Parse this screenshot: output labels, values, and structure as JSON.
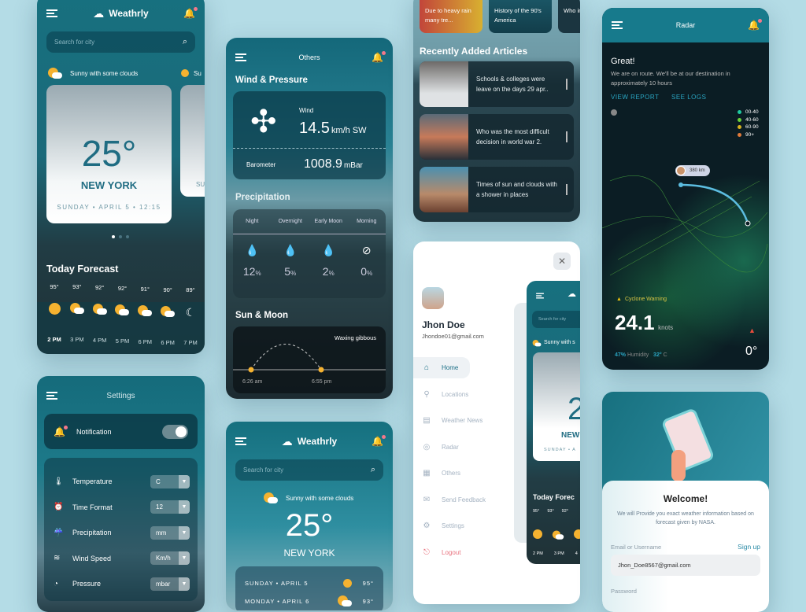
{
  "app_name": "Weathrly",
  "home": {
    "search_placeholder": "Search for city",
    "condition": "Sunny with some clouds",
    "condition2": "Su",
    "temp": "25°",
    "city": "NEW YORK",
    "datetime": "SUNDAY • APRIL 5 • 12:15",
    "next_card_text": "SU",
    "forecast_title": "Today Forecast",
    "forecast": [
      {
        "temp": "95°",
        "icon": "sun",
        "time": "2 PM"
      },
      {
        "temp": "93°",
        "icon": "partly-cloudy",
        "time": "3 PM"
      },
      {
        "temp": "92°",
        "icon": "partly-cloudy",
        "time": "4 PM"
      },
      {
        "temp": "92°",
        "icon": "partly-cloudy",
        "time": "5 PM"
      },
      {
        "temp": "91°",
        "icon": "partly-cloudy",
        "time": "6 PM"
      },
      {
        "temp": "90°",
        "icon": "partly-cloudy",
        "time": "6 PM"
      },
      {
        "temp": "89°",
        "icon": "moon-cloud",
        "time": "7 PM"
      }
    ]
  },
  "settings": {
    "title": "Settings",
    "notification_label": "Notification",
    "notification_on": true,
    "items": [
      {
        "label": "Temperature",
        "value": "C",
        "icon": "thermometer"
      },
      {
        "label": "Time Format",
        "value": "12",
        "icon": "alarm-clock"
      },
      {
        "label": "Precipitation",
        "value": "mm",
        "icon": "rain-cloud"
      },
      {
        "label": "Wind Speed",
        "value": "Km/h",
        "icon": "wind"
      },
      {
        "label": "Pressure",
        "value": "mbar",
        "icon": "gauge"
      }
    ]
  },
  "others": {
    "title": "Others",
    "wind_section": "Wind & Pressure",
    "wind_label": "Wind",
    "wind_value": "14.5",
    "wind_unit": "km/h SW",
    "barometer_label": "Barometer",
    "barometer_value": "1008.9",
    "barometer_unit": "mBar",
    "precip_section": "Precipitation",
    "precip": [
      {
        "label": "Night",
        "value": "12",
        "unit": "%"
      },
      {
        "label": "Overnight",
        "value": "5",
        "unit": "%"
      },
      {
        "label": "Early Moon",
        "value": "2",
        "unit": "%"
      },
      {
        "label": "Morning",
        "value": "0",
        "unit": "%"
      }
    ],
    "sun_section": "Sun & Moon",
    "moon_phase": "Waxing gibbous",
    "sunrise": "6:26 am",
    "sunset": "6:55 pm"
  },
  "home2": {
    "search_placeholder": "Search for city",
    "condition": "Sunny with some clouds",
    "temp": "25°",
    "city": "NEW YORK",
    "days": [
      {
        "label": "SUNDAY • APRIL 5",
        "temp": "95°",
        "icon": "sun"
      },
      {
        "label": "MONDAY • APRIL 6",
        "temp": "93°",
        "icon": "partly-cloudy"
      }
    ]
  },
  "news": {
    "top": [
      "Due to heavy rain many tre...",
      "History of the 90's America",
      "Who in w"
    ],
    "recent_title": "Recently Added Articles",
    "articles": [
      "Schools & colleges were leave on the days 29 apr..",
      "Who was the most difficult decision in world war 2.",
      "Times of sun and clouds with a shower in places"
    ]
  },
  "menu": {
    "user_name": "Jhon Doe",
    "user_email": "Jhondoe01@gmail.com",
    "items": [
      {
        "label": "Home",
        "active": true
      },
      {
        "label": "Locations"
      },
      {
        "label": "Weather News"
      },
      {
        "label": "Radar"
      },
      {
        "label": "Others"
      },
      {
        "label": "Send Feedback"
      },
      {
        "label": "Settings"
      },
      {
        "label": "Logout"
      }
    ],
    "preview": {
      "search_placeholder": "Search for city",
      "condition": "Sunny with s",
      "temp": "2",
      "city": "NEW",
      "date": "SUNDAY • A",
      "forecast_title": "Today Forec",
      "temps": [
        "95°",
        "93°",
        "92°"
      ],
      "times": [
        "2 PM",
        "3 PM",
        "4"
      ]
    }
  },
  "radar": {
    "title": "Radar",
    "heading": "Great!",
    "message": "We are on route. We'll be at our destination in approximately 10 hours",
    "view_report": "VIEW REPORT",
    "see_logs": "SEE LOGS",
    "legend": [
      {
        "label": "00-40",
        "color": "#1fc9a0"
      },
      {
        "label": "40-60",
        "color": "#6ad13a"
      },
      {
        "label": "60-90",
        "color": "#d8b21e"
      },
      {
        "label": "90+",
        "color": "#e07a3a"
      }
    ],
    "distance": "380 km",
    "warning": "Cyclone Warning",
    "speed": "24.1",
    "speed_unit": "knots",
    "humidity_value": "47%",
    "humidity_label": "Humidity",
    "temp_value": "32°",
    "temp_unit": "C",
    "heading_deg": "0°"
  },
  "welcome": {
    "title": "Welcome!",
    "subtitle": "We will Provide you exact weather information based on forecast given by NASA.",
    "email_label": "Email or Username",
    "signup": "Sign up",
    "email_value": "Jhon_Doe8567@gmail.com",
    "password_label": "Password"
  },
  "colors": {
    "teal": "#17707f",
    "accent": "#2ba6c4",
    "sun": "#f5b230",
    "logout": "#e8737f",
    "background": "#b4dce6"
  }
}
